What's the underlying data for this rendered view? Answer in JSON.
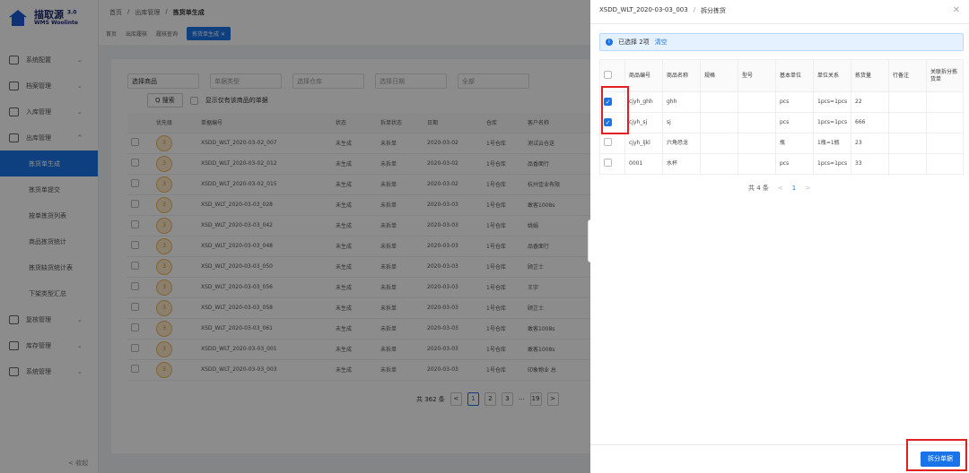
{
  "logo": {
    "name": "描取源",
    "version": "3.0",
    "sub": "WMS Woolinte"
  },
  "breadcrumb": {
    "home": "首页",
    "sep1": "/",
    "section": "出库管理",
    "sep2": "/",
    "current": "拣货单生成"
  },
  "tabs": {
    "t1": "首页",
    "t2": "出库履核",
    "t3": "履核查询",
    "t4": "拣货单生成 ✕"
  },
  "sidebar": {
    "items": [
      {
        "label": "系统配置",
        "chev": "⌄"
      },
      {
        "label": "档案管理",
        "chev": "⌄"
      },
      {
        "label": "入库管理",
        "chev": "⌄"
      },
      {
        "label": "出库管理",
        "chev": "^"
      }
    ],
    "subs": [
      "拣货单生成",
      "拣货单提交",
      "按单拣货列表",
      "商品拣货统计",
      "拣货缺货统计表",
      "下架类型汇总"
    ],
    "items2": [
      {
        "label": "复核管理",
        "chev": "⌄"
      },
      {
        "label": "库存管理",
        "chev": "⌄"
      },
      {
        "label": "系统管理",
        "chev": "⌄"
      }
    ],
    "collapse": "< 收起"
  },
  "filters": {
    "f1": "选择商品",
    "f2": "单据类型",
    "f3": "选择仓库",
    "f4": "选择日期",
    "f5": "全部"
  },
  "search_btn": "Q 搜索",
  "show_only": "显示仅有该商品的单据",
  "main_table": {
    "headers": [
      "",
      "优先级",
      "单据编号",
      "状态",
      "拆单状态",
      "日期",
      "仓库",
      "客户名称"
    ],
    "rows": [
      [
        "3",
        "XSDD_WLT_2020-03-02_007",
        "未生成",
        "未拆单",
        "2020-03-02",
        "1号仓库",
        "测试云仓送"
      ],
      [
        "3",
        "XSDD_WLT_2020-03-02_012",
        "未生成",
        "未拆单",
        "2020-03-02",
        "1号仓库",
        "品香面行"
      ],
      [
        "3",
        "XSDD_WLT_2020-03-02_015",
        "未生成",
        "未拆单",
        "2020-03-02",
        "1号仓库",
        "杭州佳业有限"
      ],
      [
        "3",
        "XSD_WLT_2020-03-03_028",
        "未生成",
        "未拆单",
        "2020-03-03",
        "1号仓库",
        "敢客1008s"
      ],
      [
        "3",
        "XSD_WLT_2020-03-03_042",
        "未生成",
        "未拆单",
        "2020-03-03",
        "1号仓库",
        "姚娟"
      ],
      [
        "3",
        "XSD_WLT_2020-03-03_048",
        "未生成",
        "未拆单",
        "2020-03-03",
        "1号仓库",
        "品香面行"
      ],
      [
        "3",
        "XSD_WLT_2020-03-03_050",
        "未生成",
        "未拆单",
        "2020-03-03",
        "1号仓库",
        "顾芷士"
      ],
      [
        "3",
        "XSD_WLT_2020-03-03_056",
        "未生成",
        "未拆单",
        "2020-03-03",
        "1号仓库",
        "王宇"
      ],
      [
        "3",
        "XSD_WLT_2020-03-03_058",
        "未生成",
        "未拆单",
        "2020-03-03",
        "1号仓库",
        "顾芷士"
      ],
      [
        "3",
        "XSD_WLT_2020-03-03_061",
        "未生成",
        "未拆单",
        "2020-03-03",
        "1号仓库",
        "敢客1008s"
      ],
      [
        "3",
        "XSDD_WLT_2020-03-03_001",
        "未生成",
        "未拆单",
        "2020-03-03",
        "1号仓库",
        "敢客1008s"
      ],
      [
        "3",
        "XSDD_WLT_2020-03-03_003",
        "未生成",
        "未拆单",
        "2020-03-03",
        "1号仓库",
        "印象物业 总"
      ]
    ]
  },
  "pager": {
    "total": "共 362 条",
    "p1": "1",
    "p2": "2",
    "p3": "3",
    "dots": "···",
    "last": "19"
  },
  "drawer": {
    "title": "XSDD_WLT_2020-03-03_003",
    "sep": "/",
    "subtitle": "拆分拣货",
    "close": "✕",
    "selected": "已选择 2项",
    "clear": "清空",
    "headers": [
      "商品编号",
      "商品名称",
      "规格",
      "型号",
      "基本单位",
      "单位关系",
      "拣货量",
      "行备注",
      "关联拆分拣货单"
    ],
    "rows": [
      {
        "checked": true,
        "code": "cjyh_ghh",
        "name": "ghh",
        "spec": "",
        "model": "",
        "unit": "pcs",
        "rel": "1pcs=1pcs",
        "qty": "22"
      },
      {
        "checked": true,
        "code": "cjyh_sj",
        "name": "sj",
        "spec": "",
        "model": "",
        "unit": "pcs",
        "rel": "1pcs=1pcs",
        "qty": "666"
      },
      {
        "checked": false,
        "code": "cjyh_ljkl",
        "name": "六角恐龙",
        "spec": "",
        "model": "",
        "unit": "瓶",
        "rel": "1瓶=1瓶",
        "qty": "23"
      },
      {
        "checked": false,
        "code": "0001",
        "name": "水杯",
        "spec": "",
        "model": "",
        "unit": "pcs",
        "rel": "1pcs=1pcs",
        "qty": "33"
      }
    ],
    "pager_total": "共 4 条",
    "pager_prev": "<",
    "pager_cur": "1",
    "pager_next": ">",
    "split_btn": "拆分单据"
  },
  "colors": {
    "accent": "#1a73e8",
    "highlight": "#e02020"
  }
}
